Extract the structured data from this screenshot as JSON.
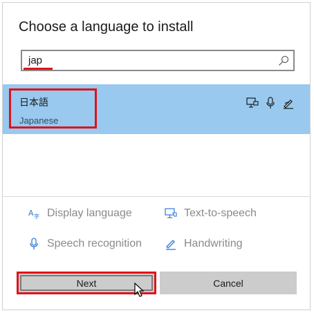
{
  "dialog": {
    "title": "Choose a language to install"
  },
  "search": {
    "value": "jap",
    "icon": "search-icon"
  },
  "languages": [
    {
      "native_name": "日本語",
      "english_name": "Japanese",
      "selected": true,
      "capabilities": [
        "display-language-icon",
        "speech-icon",
        "handwriting-icon"
      ]
    }
  ],
  "features": [
    {
      "label": "Display language",
      "icon": "display-language-icon"
    },
    {
      "label": "Text-to-speech",
      "icon": "text-to-speech-icon"
    },
    {
      "label": "Speech recognition",
      "icon": "microphone-icon"
    },
    {
      "label": "Handwriting",
      "icon": "handwriting-icon"
    }
  ],
  "buttons": {
    "next_label": "Next",
    "cancel_label": "Cancel"
  },
  "colors": {
    "accent_highlight": "#e0121a",
    "selection": "#99c9ee"
  }
}
